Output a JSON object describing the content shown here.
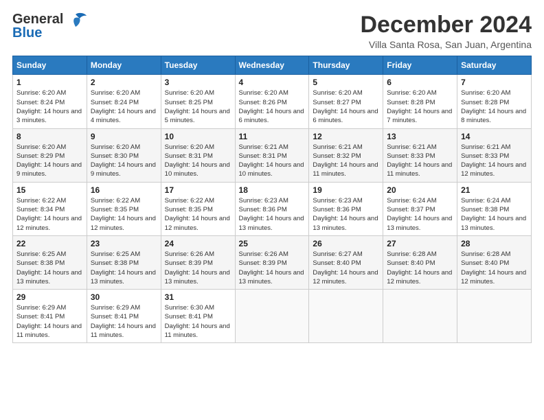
{
  "logo": {
    "line1": "General",
    "line2": "Blue"
  },
  "header": {
    "month": "December 2024",
    "location": "Villa Santa Rosa, San Juan, Argentina"
  },
  "weekdays": [
    "Sunday",
    "Monday",
    "Tuesday",
    "Wednesday",
    "Thursday",
    "Friday",
    "Saturday"
  ],
  "weeks": [
    [
      {
        "day": "1",
        "sunrise": "Sunrise: 6:20 AM",
        "sunset": "Sunset: 8:24 PM",
        "daylight": "Daylight: 14 hours and 3 minutes."
      },
      {
        "day": "2",
        "sunrise": "Sunrise: 6:20 AM",
        "sunset": "Sunset: 8:24 PM",
        "daylight": "Daylight: 14 hours and 4 minutes."
      },
      {
        "day": "3",
        "sunrise": "Sunrise: 6:20 AM",
        "sunset": "Sunset: 8:25 PM",
        "daylight": "Daylight: 14 hours and 5 minutes."
      },
      {
        "day": "4",
        "sunrise": "Sunrise: 6:20 AM",
        "sunset": "Sunset: 8:26 PM",
        "daylight": "Daylight: 14 hours and 6 minutes."
      },
      {
        "day": "5",
        "sunrise": "Sunrise: 6:20 AM",
        "sunset": "Sunset: 8:27 PM",
        "daylight": "Daylight: 14 hours and 6 minutes."
      },
      {
        "day": "6",
        "sunrise": "Sunrise: 6:20 AM",
        "sunset": "Sunset: 8:28 PM",
        "daylight": "Daylight: 14 hours and 7 minutes."
      },
      {
        "day": "7",
        "sunrise": "Sunrise: 6:20 AM",
        "sunset": "Sunset: 8:28 PM",
        "daylight": "Daylight: 14 hours and 8 minutes."
      }
    ],
    [
      {
        "day": "8",
        "sunrise": "Sunrise: 6:20 AM",
        "sunset": "Sunset: 8:29 PM",
        "daylight": "Daylight: 14 hours and 9 minutes."
      },
      {
        "day": "9",
        "sunrise": "Sunrise: 6:20 AM",
        "sunset": "Sunset: 8:30 PM",
        "daylight": "Daylight: 14 hours and 9 minutes."
      },
      {
        "day": "10",
        "sunrise": "Sunrise: 6:20 AM",
        "sunset": "Sunset: 8:31 PM",
        "daylight": "Daylight: 14 hours and 10 minutes."
      },
      {
        "day": "11",
        "sunrise": "Sunrise: 6:21 AM",
        "sunset": "Sunset: 8:31 PM",
        "daylight": "Daylight: 14 hours and 10 minutes."
      },
      {
        "day": "12",
        "sunrise": "Sunrise: 6:21 AM",
        "sunset": "Sunset: 8:32 PM",
        "daylight": "Daylight: 14 hours and 11 minutes."
      },
      {
        "day": "13",
        "sunrise": "Sunrise: 6:21 AM",
        "sunset": "Sunset: 8:33 PM",
        "daylight": "Daylight: 14 hours and 11 minutes."
      },
      {
        "day": "14",
        "sunrise": "Sunrise: 6:21 AM",
        "sunset": "Sunset: 8:33 PM",
        "daylight": "Daylight: 14 hours and 12 minutes."
      }
    ],
    [
      {
        "day": "15",
        "sunrise": "Sunrise: 6:22 AM",
        "sunset": "Sunset: 8:34 PM",
        "daylight": "Daylight: 14 hours and 12 minutes."
      },
      {
        "day": "16",
        "sunrise": "Sunrise: 6:22 AM",
        "sunset": "Sunset: 8:35 PM",
        "daylight": "Daylight: 14 hours and 12 minutes."
      },
      {
        "day": "17",
        "sunrise": "Sunrise: 6:22 AM",
        "sunset": "Sunset: 8:35 PM",
        "daylight": "Daylight: 14 hours and 12 minutes."
      },
      {
        "day": "18",
        "sunrise": "Sunrise: 6:23 AM",
        "sunset": "Sunset: 8:36 PM",
        "daylight": "Daylight: 14 hours and 13 minutes."
      },
      {
        "day": "19",
        "sunrise": "Sunrise: 6:23 AM",
        "sunset": "Sunset: 8:36 PM",
        "daylight": "Daylight: 14 hours and 13 minutes."
      },
      {
        "day": "20",
        "sunrise": "Sunrise: 6:24 AM",
        "sunset": "Sunset: 8:37 PM",
        "daylight": "Daylight: 14 hours and 13 minutes."
      },
      {
        "day": "21",
        "sunrise": "Sunrise: 6:24 AM",
        "sunset": "Sunset: 8:38 PM",
        "daylight": "Daylight: 14 hours and 13 minutes."
      }
    ],
    [
      {
        "day": "22",
        "sunrise": "Sunrise: 6:25 AM",
        "sunset": "Sunset: 8:38 PM",
        "daylight": "Daylight: 14 hours and 13 minutes."
      },
      {
        "day": "23",
        "sunrise": "Sunrise: 6:25 AM",
        "sunset": "Sunset: 8:38 PM",
        "daylight": "Daylight: 14 hours and 13 minutes."
      },
      {
        "day": "24",
        "sunrise": "Sunrise: 6:26 AM",
        "sunset": "Sunset: 8:39 PM",
        "daylight": "Daylight: 14 hours and 13 minutes."
      },
      {
        "day": "25",
        "sunrise": "Sunrise: 6:26 AM",
        "sunset": "Sunset: 8:39 PM",
        "daylight": "Daylight: 14 hours and 13 minutes."
      },
      {
        "day": "26",
        "sunrise": "Sunrise: 6:27 AM",
        "sunset": "Sunset: 8:40 PM",
        "daylight": "Daylight: 14 hours and 12 minutes."
      },
      {
        "day": "27",
        "sunrise": "Sunrise: 6:28 AM",
        "sunset": "Sunset: 8:40 PM",
        "daylight": "Daylight: 14 hours and 12 minutes."
      },
      {
        "day": "28",
        "sunrise": "Sunrise: 6:28 AM",
        "sunset": "Sunset: 8:40 PM",
        "daylight": "Daylight: 14 hours and 12 minutes."
      }
    ],
    [
      {
        "day": "29",
        "sunrise": "Sunrise: 6:29 AM",
        "sunset": "Sunset: 8:41 PM",
        "daylight": "Daylight: 14 hours and 11 minutes."
      },
      {
        "day": "30",
        "sunrise": "Sunrise: 6:29 AM",
        "sunset": "Sunset: 8:41 PM",
        "daylight": "Daylight: 14 hours and 11 minutes."
      },
      {
        "day": "31",
        "sunrise": "Sunrise: 6:30 AM",
        "sunset": "Sunset: 8:41 PM",
        "daylight": "Daylight: 14 hours and 11 minutes."
      },
      null,
      null,
      null,
      null
    ]
  ]
}
